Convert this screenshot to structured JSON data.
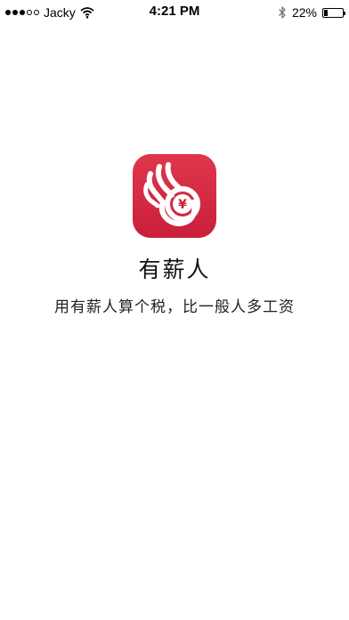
{
  "status_bar": {
    "carrier": "Jacky",
    "time": "4:21 PM",
    "battery": "22%",
    "battery_level": 0.22,
    "signal_bars_filled": 3,
    "signal_bars_total": 5
  },
  "splash": {
    "app_name": "有薪人",
    "tagline": "用有薪人算个税，比一般人多工资",
    "icon_symbol": "¥",
    "icon_name": "ok-hand-yen-icon",
    "brand_color": "#d42a44"
  }
}
